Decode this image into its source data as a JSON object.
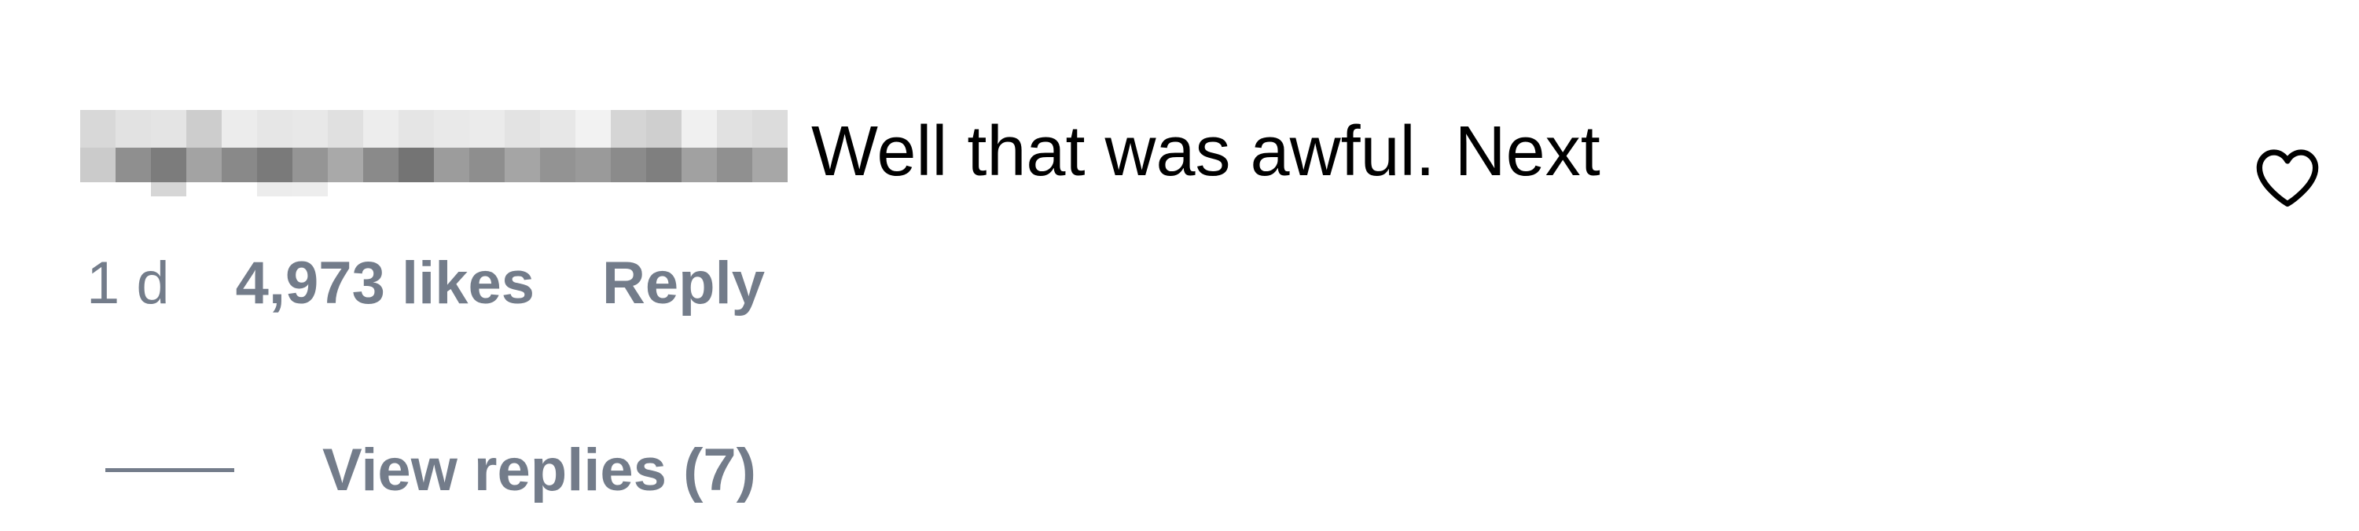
{
  "comment": {
    "author_redacted": true,
    "text": "Well that was awful. Next",
    "timestamp": "1 d",
    "likes_label": "4,973 likes",
    "reply_label": "Reply",
    "view_replies_label": "View replies (7)"
  },
  "icons": {
    "like": "heart-outline-icon"
  },
  "colors": {
    "text_primary": "#000000",
    "text_secondary": "#737c8a",
    "background": "#ffffff"
  }
}
